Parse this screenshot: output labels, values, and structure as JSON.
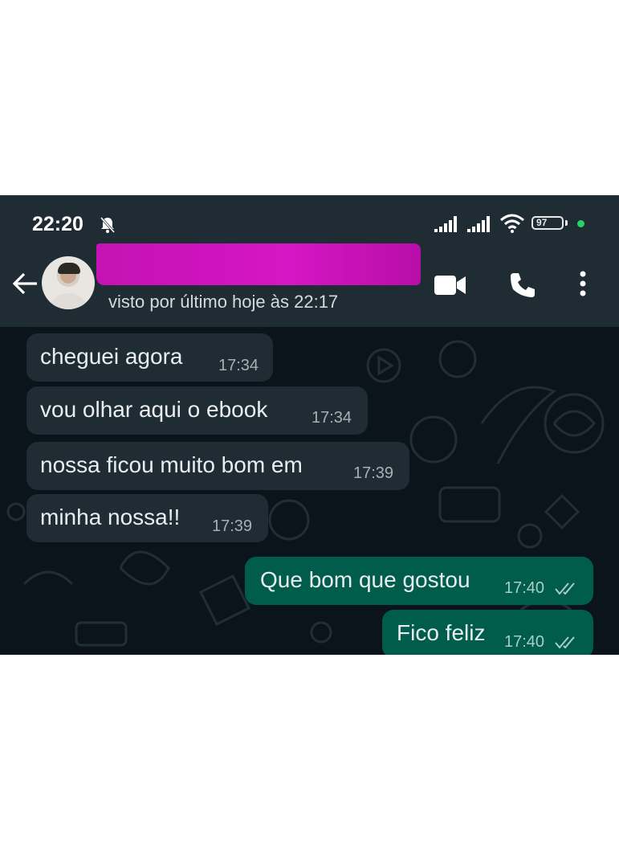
{
  "status_bar": {
    "time": "22:20",
    "battery": "97",
    "icons": [
      "mute-notification-icon",
      "signal-icon",
      "signal-icon",
      "wifi-icon",
      "battery-icon"
    ]
  },
  "contact": {
    "name_redacted": true,
    "last_seen": "visto por último hoje às 22:17"
  },
  "header_actions": [
    "back-arrow-icon",
    "video-call-icon",
    "voice-call-icon",
    "more-options-icon"
  ],
  "messages": [
    {
      "direction": "incoming",
      "text": "cheguei agora",
      "time": "17:34"
    },
    {
      "direction": "incoming",
      "text": "vou olhar aqui o ebook",
      "time": "17:34"
    },
    {
      "direction": "incoming",
      "text": "nossa ficou muito bom em",
      "time": "17:39"
    },
    {
      "direction": "incoming",
      "text": "minha nossa!!",
      "time": "17:39"
    },
    {
      "direction": "outgoing",
      "text": "Que bom que gostou",
      "time": "17:40",
      "status": "read"
    },
    {
      "direction": "outgoing",
      "text": "Fico feliz",
      "time": "17:40",
      "status": "read"
    }
  ],
  "colors": {
    "header_bg": "#1f2c34",
    "chat_bg": "#0b141a",
    "incoming_bubble": "#1f2c34",
    "outgoing_bubble": "#005c4b",
    "redaction": "#d516c4",
    "online_dot": "#25d366"
  }
}
